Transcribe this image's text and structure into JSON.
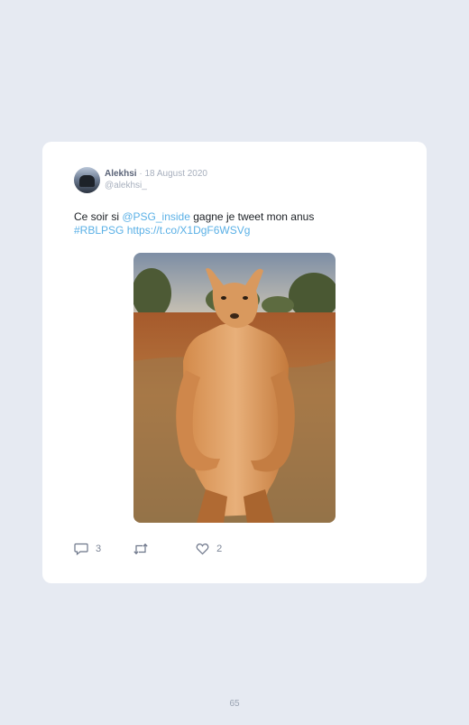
{
  "tweet": {
    "author_name": "Alekhsi",
    "separator": "·",
    "date": "18 August 2020",
    "handle": "@alekhsi_",
    "text_start": "Ce soir si ",
    "mention": "@PSG_inside",
    "text_mid": " gagne je tweet mon anus",
    "hashtag": "#RBLPSG",
    "url": "https://t.co/X1DgF6WSVg",
    "media_description_icon": "kangaroo-photo",
    "link_color": "#5ab0e6",
    "reply_count": "3",
    "like_count": "2"
  },
  "page": {
    "number": "65"
  }
}
